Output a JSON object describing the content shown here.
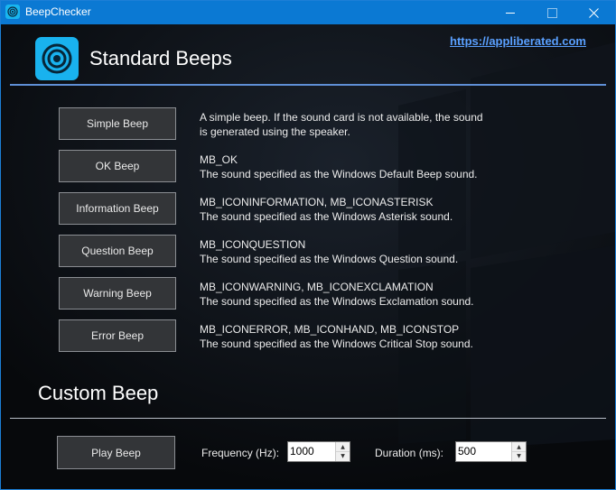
{
  "window": {
    "title": "BeepChecker"
  },
  "header": {
    "title": "Standard Beeps",
    "link": "https://appliberated.com"
  },
  "standard_beeps": [
    {
      "button": "Simple Beep",
      "line1": "A simple beep. If the sound card is not available, the sound",
      "line2": "is generated using the speaker."
    },
    {
      "button": "OK Beep",
      "line1": "MB_OK",
      "line2": "The sound specified as the Windows Default Beep sound."
    },
    {
      "button": "Information Beep",
      "line1": "MB_ICONINFORMATION, MB_ICONASTERISK",
      "line2": "The sound specified as the Windows Asterisk sound."
    },
    {
      "button": "Question Beep",
      "line1": "MB_ICONQUESTION",
      "line2": "The sound specified as the Windows Question sound."
    },
    {
      "button": "Warning Beep",
      "line1": "MB_ICONWARNING, MB_ICONEXCLAMATION",
      "line2": "The sound specified as the Windows Exclamation sound."
    },
    {
      "button": "Error Beep",
      "line1": "MB_ICONERROR, MB_ICONHAND, MB_ICONSTOP",
      "line2": "The sound specified as the Windows Critical Stop sound."
    }
  ],
  "custom": {
    "title": "Custom Beep",
    "play_label": "Play Beep",
    "frequency_label": "Frequency (Hz):",
    "frequency_value": "1000",
    "duration_label": "Duration (ms):",
    "duration_value": "500"
  },
  "colors": {
    "titlebar": "#0b79d3",
    "accent_logo": "#19b2ee",
    "link": "#5aa0ff",
    "background": "#0a0d12"
  }
}
